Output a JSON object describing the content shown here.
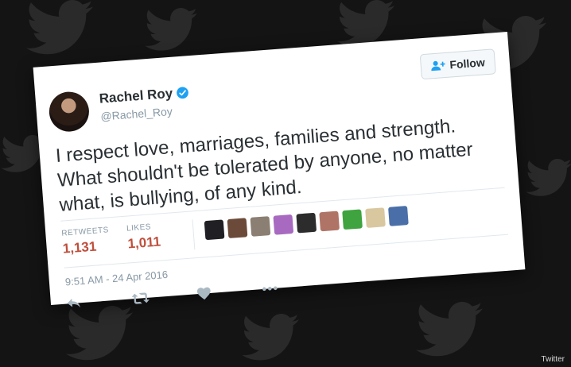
{
  "tweet": {
    "display_name": "Rachel Roy",
    "handle": "@Rachel_Roy",
    "follow_label": "Follow",
    "text": "I respect love, marriages, families and strength. What shouldn't be tolerated by anyone, no matter what, is bullying, of any kind.",
    "retweets_label": "RETWEETS",
    "retweets_count": "1,131",
    "likes_label": "LIKES",
    "likes_count": "1,011",
    "timestamp": "9:51 AM - 24 Apr 2016"
  },
  "likers": [
    {
      "color": "#1f1f24"
    },
    {
      "color": "#6b4a3a"
    },
    {
      "color": "#8a7f72"
    },
    {
      "color": "#a86ac0"
    },
    {
      "color": "#2c2c2c"
    },
    {
      "color": "#b07466"
    },
    {
      "color": "#3fa33f"
    },
    {
      "color": "#d9c7a0"
    },
    {
      "color": "#4a6fa8"
    }
  ],
  "icons": {
    "verified": "verified-badge-icon",
    "follow": "follow-person-plus-icon",
    "reply": "reply-icon",
    "retweet": "retweet-icon",
    "like": "heart-icon",
    "more": "more-dots-icon"
  },
  "colors": {
    "verified_blue": "#1da1f2",
    "count_red": "#bf4f3c",
    "follow_blue": "#1da1f2"
  },
  "credit": "Twitter"
}
